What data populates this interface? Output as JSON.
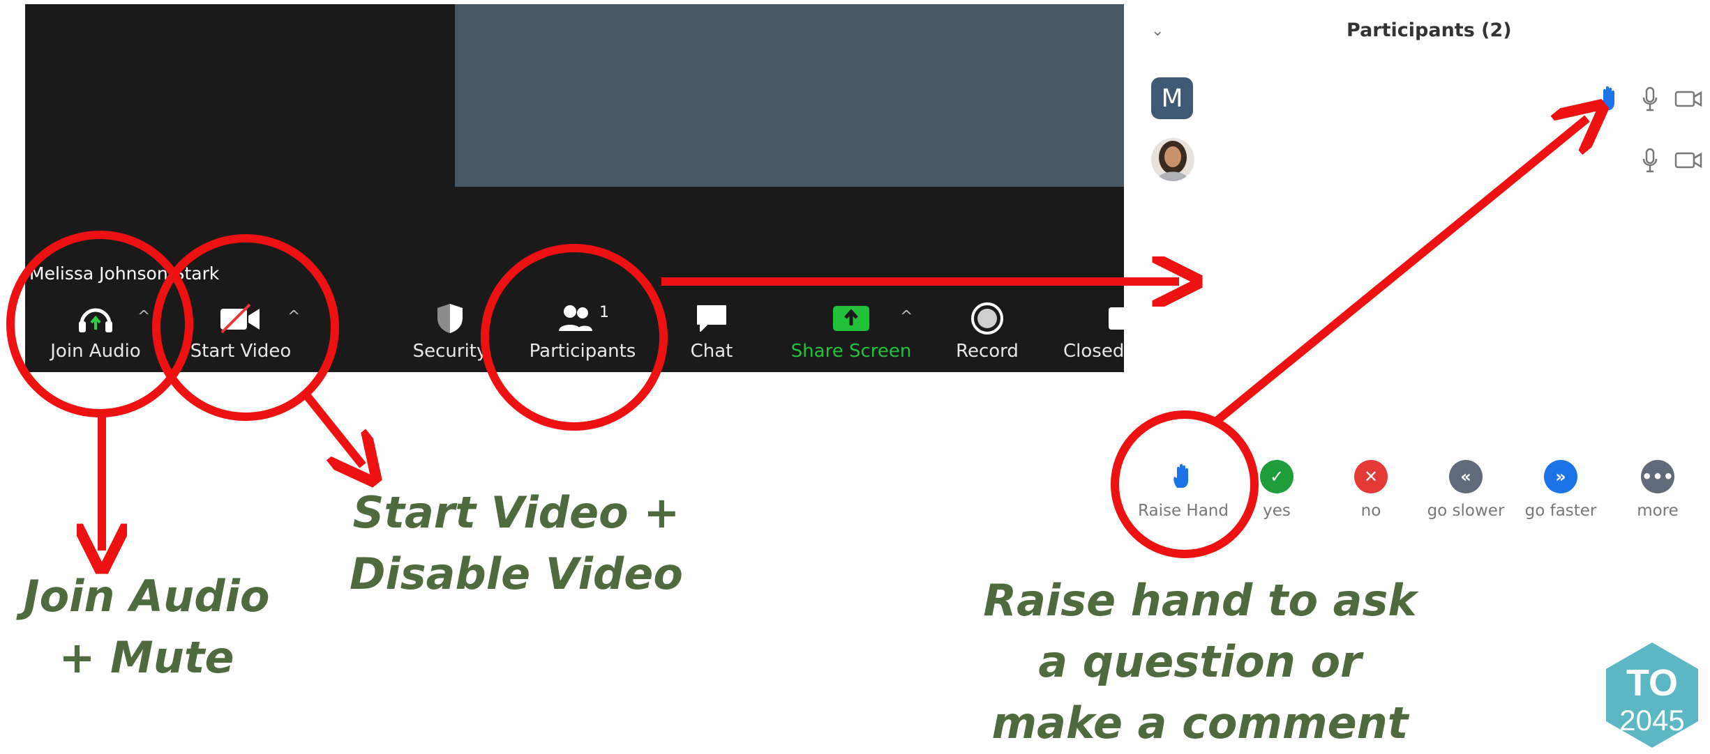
{
  "meeting": {
    "participant_name": "Melissa Johnson Stark"
  },
  "toolbar": {
    "items": [
      {
        "label": "Join Audio",
        "icon": "headphones-icon"
      },
      {
        "label": "Start Video",
        "icon": "video-off-icon"
      },
      {
        "label": "Security",
        "icon": "shield-icon"
      },
      {
        "label": "Participants",
        "icon": "participants-icon",
        "count": "1"
      },
      {
        "label": "Chat",
        "icon": "chat-icon"
      },
      {
        "label": "Share Screen",
        "icon": "share-screen-icon"
      },
      {
        "label": "Record",
        "icon": "record-icon"
      },
      {
        "label": "Closed",
        "icon": "closed-caption-icon"
      }
    ]
  },
  "participants_panel": {
    "title": "Participants (2)",
    "participants": [
      {
        "avatar_letter": "M",
        "hand_raised": true
      },
      {
        "avatar_letter": "",
        "hand_raised": false
      }
    ],
    "reactions": [
      {
        "label": "Raise Hand",
        "icon": "raise-hand-icon",
        "color": "#1a73e8"
      },
      {
        "label": "yes",
        "icon": "check-icon",
        "color": "#1e9e3a"
      },
      {
        "label": "no",
        "icon": "x-icon",
        "color": "#e53935"
      },
      {
        "label": "go slower",
        "icon": "go-slower-icon",
        "color": "#5f6b7a"
      },
      {
        "label": "go faster",
        "icon": "go-faster-icon",
        "color": "#1a73e8"
      },
      {
        "label": "more",
        "icon": "more-icon",
        "color": "#5f6b7a"
      }
    ]
  },
  "annotations": {
    "join_audio": [
      "Join Audio",
      "+ Mute"
    ],
    "start_video": [
      "Start Video +",
      "Disable Video"
    ],
    "raise_hand": [
      "Raise hand to ask",
      "a question or",
      "make a comment"
    ]
  },
  "badge": {
    "line1": "TO",
    "line2": "2045"
  },
  "colors": {
    "annotation_red": "#ee1111",
    "annotation_green": "#4d6b3c",
    "share_green": "#22c33a",
    "badge_teal": "#5bb7c3"
  }
}
